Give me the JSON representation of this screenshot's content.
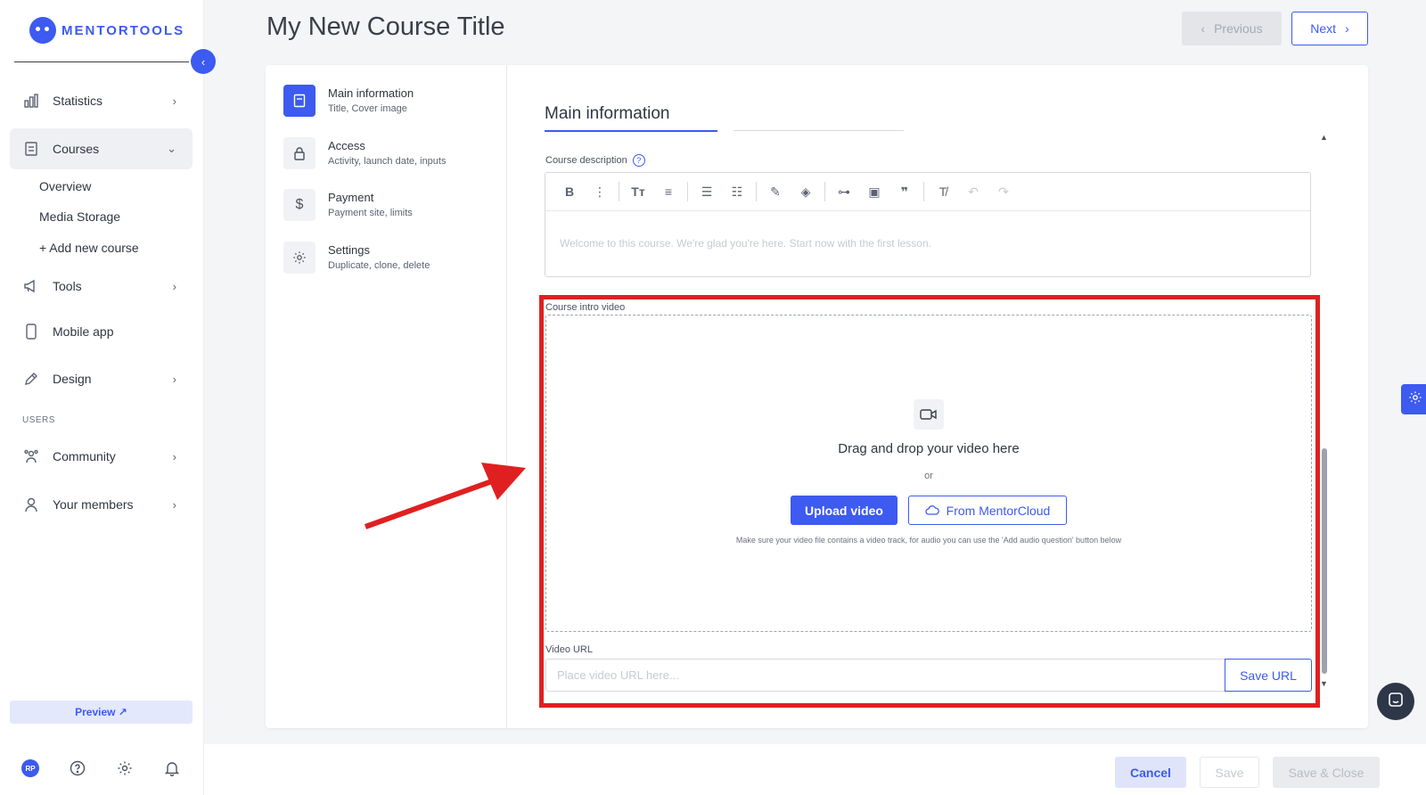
{
  "brand": {
    "name": "MENTORTOOLS",
    "accent": "#3d5af1"
  },
  "sidebar": {
    "items": [
      {
        "label": "Statistics",
        "icon": "bar-chart-icon"
      },
      {
        "label": "Courses",
        "icon": "book-icon"
      },
      {
        "label": "Tools",
        "icon": "megaphone-icon"
      },
      {
        "label": "Mobile app",
        "icon": "phone-icon"
      },
      {
        "label": "Design",
        "icon": "edit-icon"
      },
      {
        "label": "Community",
        "icon": "people-icon"
      },
      {
        "label": "Your members",
        "icon": "user-icon"
      }
    ],
    "courses_sub": [
      "Overview",
      "Media Storage",
      "+ Add new course"
    ],
    "users_label": "USERS",
    "preview_label": "Preview ↗",
    "avatar_initials": "RP"
  },
  "header": {
    "title": "My New Course Title",
    "previous_label": "Previous",
    "next_label": "Next"
  },
  "steps": [
    {
      "title": "Main information",
      "sub": "Title, Cover image",
      "icon": "book-icon"
    },
    {
      "title": "Access",
      "sub": "Activity, launch date, inputs",
      "icon": "lock-icon"
    },
    {
      "title": "Payment",
      "sub": "Payment site, limits",
      "icon": "dollar-icon"
    },
    {
      "title": "Settings",
      "sub": "Duplicate, clone, delete",
      "icon": "gear-icon"
    }
  ],
  "main": {
    "section_title": "Main information",
    "description_label": "Course description",
    "description_placeholder": "Welcome to this course. We're glad you're here. Start now with the first lesson.",
    "intro_video_label": "Course intro video",
    "drop_text": "Drag and drop your video here",
    "or_text": "or",
    "upload_label": "Upload video",
    "cloud_label": "From MentorCloud",
    "hint": "Make sure your video file contains a video track, for audio you can use the 'Add audio question' button below",
    "video_url_label": "Video URL",
    "video_url_placeholder": "Place video URL here...",
    "save_url_label": "Save URL"
  },
  "footer": {
    "cancel_label": "Cancel",
    "save_label": "Save",
    "save_close_label": "Save & Close"
  }
}
